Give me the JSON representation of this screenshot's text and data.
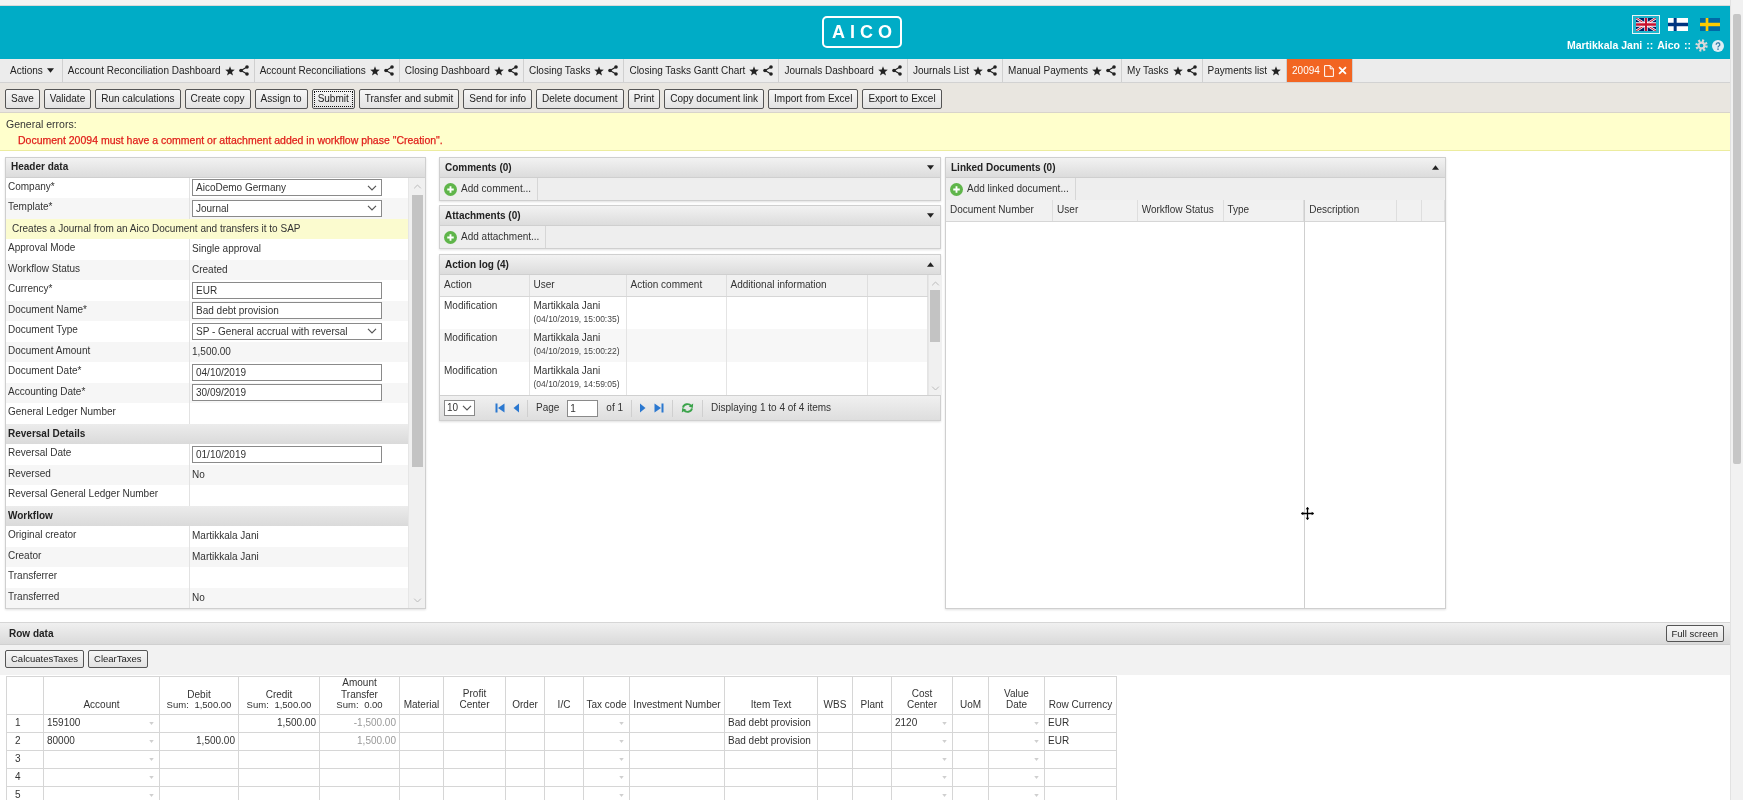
{
  "header": {
    "logo": "AICO",
    "languages": [
      {
        "kind": "uk",
        "selected": true
      },
      {
        "kind": "fi",
        "selected": false
      },
      {
        "kind": "se",
        "selected": false
      }
    ],
    "user": "Martikkala Jani",
    "separator_1": "::",
    "app": "Aico",
    "separator_2": "::"
  },
  "tabs": {
    "menu": "Actions",
    "items": [
      {
        "label": "Account Reconciliation Dashboard",
        "selected": false,
        "share": true
      },
      {
        "label": "Account Reconciliations",
        "selected": false,
        "share": true
      },
      {
        "label": "Closing Dashboard",
        "selected": false,
        "share": true
      },
      {
        "label": "Closing Tasks",
        "selected": false,
        "share": true
      },
      {
        "label": "Closing Tasks Gantt Chart",
        "selected": false,
        "share": true
      },
      {
        "label": "Journals Dashboard",
        "selected": false,
        "share": true
      },
      {
        "label": "Journals List",
        "selected": false,
        "share": true
      },
      {
        "label": "Manual Payments",
        "selected": false,
        "share": true
      },
      {
        "label": "My Tasks",
        "selected": false,
        "share": true
      },
      {
        "label": "Payments list",
        "selected": false,
        "share": false
      },
      {
        "label": "20094",
        "selected": true,
        "share": false
      }
    ]
  },
  "toolbar": {
    "buttons": [
      {
        "label": "Save",
        "focused": false
      },
      {
        "label": "Validate",
        "focused": false
      },
      {
        "label": "Run calculations",
        "focused": false
      },
      {
        "label": "Create copy",
        "focused": false
      },
      {
        "label": "Assign to",
        "focused": false
      },
      {
        "label": "Submit",
        "focused": true
      },
      {
        "label": "Transfer and submit",
        "focused": false
      },
      {
        "label": "Send for info",
        "focused": false
      },
      {
        "label": "Delete document",
        "focused": false
      },
      {
        "label": "Print",
        "focused": false
      },
      {
        "label": "Copy document link",
        "focused": false
      },
      {
        "label": "Import from Excel",
        "focused": false
      },
      {
        "label": "Export to Excel",
        "focused": false
      }
    ]
  },
  "errors": {
    "title": "General errors:",
    "messages": [
      "Document 20094 must have a comment or attachment added in workflow phase \"Creation\"."
    ]
  },
  "header_data": {
    "title": "Header data",
    "rows": [
      {
        "kind": "select",
        "label": "Company*",
        "value": "AicoDemo Germany"
      },
      {
        "kind": "select",
        "label": "Template*",
        "value": "Journal"
      },
      {
        "kind": "note",
        "label": "Creates a Journal from an Aico Document and transfers it to SAP"
      },
      {
        "kind": "text",
        "label": "Approval Mode",
        "value": "Single approval"
      },
      {
        "kind": "text",
        "label": "Workflow Status",
        "value": "Created"
      },
      {
        "kind": "input",
        "label": "Currency*",
        "value": "EUR"
      },
      {
        "kind": "input",
        "label": "Document Name*",
        "value": "Bad debt provision"
      },
      {
        "kind": "select",
        "label": "Document Type",
        "value": "SP - General accrual with reversal"
      },
      {
        "kind": "text",
        "label": "Document Amount",
        "value": "1,500.00"
      },
      {
        "kind": "input",
        "label": "Document Date*",
        "value": "04/10/2019"
      },
      {
        "kind": "input",
        "label": "Accounting Date*",
        "value": "30/09/2019"
      },
      {
        "kind": "text",
        "label": "General Ledger Number"
      },
      {
        "kind": "section",
        "label": "Reversal Details"
      },
      {
        "kind": "input",
        "label": "Reversal Date",
        "value": "01/10/2019"
      },
      {
        "kind": "text",
        "label": "Reversed",
        "value": "No"
      },
      {
        "kind": "text",
        "label": "Reversal General Ledger Number"
      },
      {
        "kind": "section",
        "label": "Workflow"
      },
      {
        "kind": "text",
        "label": "Original creator",
        "value": "Martikkala Jani"
      },
      {
        "kind": "text",
        "label": "Creator",
        "value": "Martikkala Jani"
      },
      {
        "kind": "text",
        "label": "Transferrer"
      },
      {
        "kind": "text",
        "label": "Transferred",
        "value": "No"
      }
    ]
  },
  "comments": {
    "title": "Comments (0)",
    "expanded": false,
    "add_button": "Add comment..."
  },
  "attachments": {
    "title": "Attachments (0)",
    "expanded": false,
    "add_button": "Add attachment..."
  },
  "action_log": {
    "title": "Action log (4)",
    "expanded": true,
    "columns": [
      "Action",
      "User",
      "Action comment",
      "Additional information"
    ],
    "rows": [
      {
        "action": "Modification",
        "user": "Martikkala Jani",
        "time": "(04/10/2019, 15:00:35)"
      },
      {
        "action": "Modification",
        "user": "Martikkala Jani",
        "time": "(04/10/2019, 15:00:22)"
      },
      {
        "action": "Modification",
        "user": "Martikkala Jani",
        "time": "(04/10/2019, 14:59:05)"
      }
    ],
    "pager": {
      "page_size": "10",
      "page_label": "Page",
      "page": "1",
      "page_count": "of 1",
      "summary": "Displaying 1 to 4 of 4 items"
    }
  },
  "linked_documents": {
    "title": "Linked Documents (0)",
    "expanded": true,
    "add_button": "Add linked document...",
    "columns": [
      "Document Number",
      "User",
      "Workflow Status",
      "Type",
      "Description"
    ]
  },
  "row_data": {
    "title": "Row data",
    "full_screen_button": "Full screen",
    "buttons": [
      "CalcuatesTaxes",
      "ClearTaxes"
    ],
    "columns": [
      {
        "label": "Account",
        "kind": "select"
      },
      {
        "label": "Debit",
        "sum": "Sum: 1,500.00",
        "kind": "amount"
      },
      {
        "label": "Credit",
        "sum": "Sum: 1,500.00",
        "kind": "amount"
      },
      {
        "label": "Amount Transfer",
        "sum": "Sum: 0.00",
        "kind": "computed"
      },
      {
        "label": "Material",
        "kind": "text"
      },
      {
        "label": "Profit Center",
        "kind": "text"
      },
      {
        "label": "Order",
        "kind": "text"
      },
      {
        "label": "I/C",
        "kind": "text"
      },
      {
        "label": "Tax code",
        "kind": "select"
      },
      {
        "label": "Investment Number",
        "kind": "text"
      },
      {
        "label": "Item Text",
        "kind": "text"
      },
      {
        "label": "WBS",
        "kind": "text"
      },
      {
        "label": "Plant",
        "kind": "text"
      },
      {
        "label": "Cost Center",
        "kind": "select"
      },
      {
        "label": "UoM",
        "kind": "text"
      },
      {
        "label": "Value Date",
        "kind": "select"
      },
      {
        "label": "Row Currency",
        "kind": "text"
      }
    ],
    "rows": [
      {
        "number": "1",
        "cells": [
          "159100",
          null,
          "1,500.00",
          "-1,500.00",
          null,
          null,
          null,
          null,
          null,
          null,
          "Bad debt provision",
          null,
          null,
          "2120",
          null,
          null,
          "EUR"
        ]
      },
      {
        "number": "2",
        "cells": [
          "80000",
          "1,500.00",
          null,
          "1,500.00",
          null,
          null,
          null,
          null,
          null,
          null,
          "Bad debt provision",
          null,
          null,
          null,
          null,
          null,
          "EUR"
        ]
      },
      {
        "number": "3"
      },
      {
        "number": "4"
      },
      {
        "number": "5"
      }
    ]
  }
}
